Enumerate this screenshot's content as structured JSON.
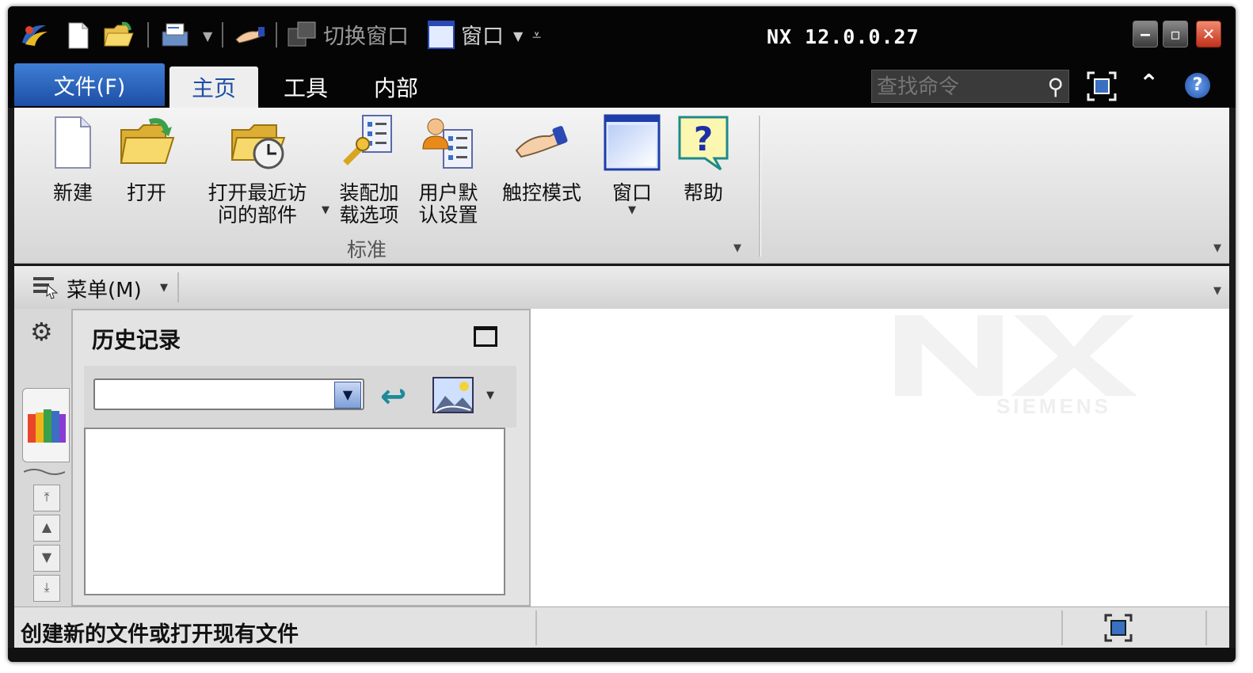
{
  "titlebar": {
    "app_title": "NX 12.0.0.27",
    "quick_access": {
      "switch_window_label": "切换窗口",
      "window_label": "窗口"
    }
  },
  "tabs": {
    "file_label": "文件(F)",
    "home_label": "主页",
    "tools_label": "工具",
    "internal_label": "内部"
  },
  "search": {
    "placeholder": "查找命令"
  },
  "ribbon": {
    "buttons": {
      "new": "新建",
      "open": "打开",
      "recent_line1": "打开最近访",
      "recent_line2": "问的部件",
      "assembly_line1": "装配加",
      "assembly_line2": "载选项",
      "user_line1": "用户默",
      "user_line2": "认设置",
      "touch": "触控模式",
      "window": "窗口",
      "help": "帮助"
    },
    "group_label": "标准"
  },
  "menubar": {
    "menu_label": "菜单(M)"
  },
  "history_panel": {
    "title": "历史记录",
    "combo_value": ""
  },
  "graphics": {
    "watermark_logo": "NX",
    "watermark_brand": "SIEMENS"
  },
  "status": {
    "message": "创建新的文件或打开现有文件"
  },
  "colors": {
    "file_tab": "#2a63bf",
    "title_bg": "#050505",
    "close_btn": "#d9452b",
    "active_tab_text": "#1d4fa5"
  }
}
